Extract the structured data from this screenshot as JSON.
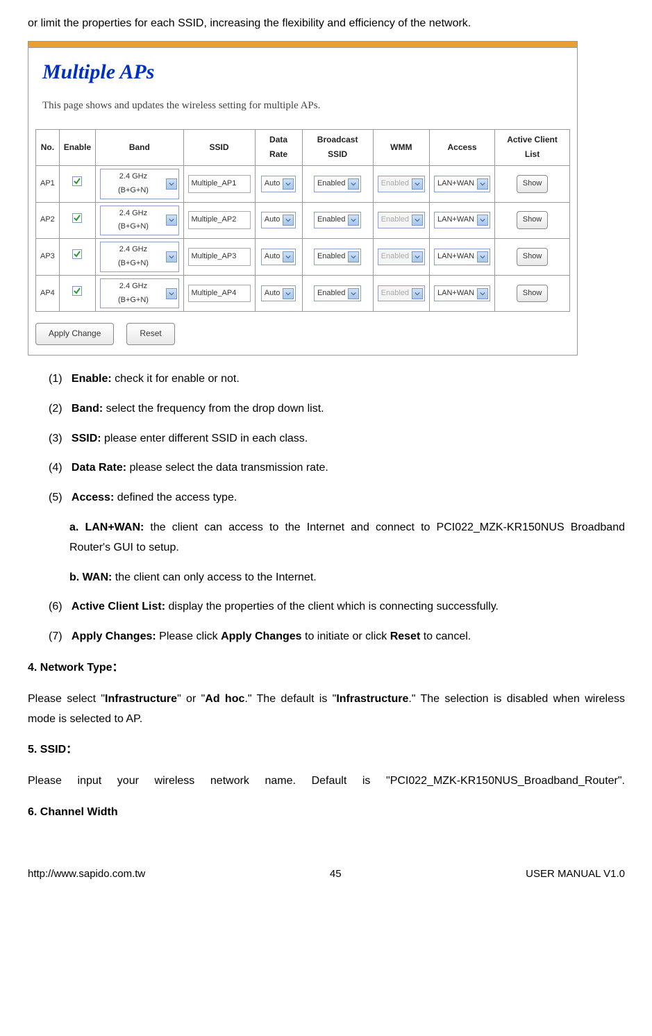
{
  "intro": "or limit the properties for each SSID, increasing the flexibility and efficiency of the network.",
  "panel": {
    "title": "Multiple APs",
    "desc": "This page shows and updates the wireless setting for multiple APs.",
    "headers": {
      "no": "No.",
      "enable": "Enable",
      "band": "Band",
      "ssid": "SSID",
      "data_rate": "Data Rate",
      "broadcast_ssid": "Broadcast SSID",
      "wmm": "WMM",
      "access": "Access",
      "active_client_list": "Active Client List"
    },
    "rows": [
      {
        "no": "AP1",
        "band": "2.4 GHz (B+G+N)",
        "ssid": "Multiple_AP1",
        "rate": "Auto",
        "broadcast": "Enabled",
        "wmm": "Enabled",
        "access": "LAN+WAN",
        "show": "Show"
      },
      {
        "no": "AP2",
        "band": "2.4 GHz (B+G+N)",
        "ssid": "Multiple_AP2",
        "rate": "Auto",
        "broadcast": "Enabled",
        "wmm": "Enabled",
        "access": "LAN+WAN",
        "show": "Show"
      },
      {
        "no": "AP3",
        "band": "2.4 GHz (B+G+N)",
        "ssid": "Multiple_AP3",
        "rate": "Auto",
        "broadcast": "Enabled",
        "wmm": "Enabled",
        "access": "LAN+WAN",
        "show": "Show"
      },
      {
        "no": "AP4",
        "band": "2.4 GHz (B+G+N)",
        "ssid": "Multiple_AP4",
        "rate": "Auto",
        "broadcast": "Enabled",
        "wmm": "Enabled",
        "access": "LAN+WAN",
        "show": "Show"
      }
    ],
    "apply": "Apply Change",
    "reset": "Reset"
  },
  "items": {
    "i1_num": "(1)",
    "i1_label": "Enable:",
    "i1_text": " check it for enable or not.",
    "i2_num": "(2)",
    "i2_label": "Band:",
    "i2_text": " select the frequency from the drop down list.",
    "i3_num": "(3)",
    "i3_label": "SSID:",
    "i3_text": " please enter different SSID in each class.",
    "i4_num": "(4)",
    "i4_label": "Data Rate:",
    "i4_text": " please select the data transmission rate.",
    "i5_num": "(5)",
    "i5_label": "Access:",
    "i5_text": " defined the access type.",
    "i5a_label": "a. LAN+WAN:",
    "i5a_text": " the client can access to the Internet and connect to PCI022_MZK-KR150NUS Broadband Router's GUI to setup.",
    "i5b_label": "b. WAN:",
    "i5b_text": " the client can only access to the Internet.",
    "i6_num": "(6)",
    "i6_label": "Active Client List:",
    "i6_text": " display the properties of the client which is connecting successfully.",
    "i7_num": "(7)",
    "i7_label": "Apply Changes:",
    "i7_text_a": " Please click ",
    "i7_apply": "Apply Changes",
    "i7_text_b": " to initiate or click ",
    "i7_reset": "Reset",
    "i7_text_c": " to cancel."
  },
  "sec4": {
    "heading": "4.    Network Type：",
    "p1_a": "Please select \"",
    "p1_b": "Infrastructure",
    "p1_c": "\" or \"",
    "p1_d": "Ad hoc",
    "p1_e": ".\" The default is \"",
    "p1_f": "Infrastructure",
    "p1_g": ".\" The selection is disabled when wireless mode is selected to AP."
  },
  "sec5": {
    "heading": "5.   SSID：",
    "p": "Please input your wireless network name. Default is \"PCI022_MZK-KR150NUS_Broadband_Router\"."
  },
  "sec6": {
    "heading": "6.   Channel Width"
  },
  "footer": {
    "left": "http://www.sapido.com.tw",
    "center": "45",
    "right": "USER MANUAL V1.0"
  }
}
